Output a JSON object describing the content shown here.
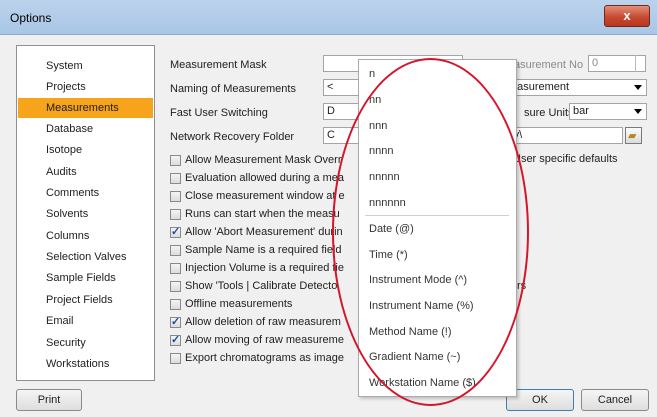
{
  "window": {
    "title": "Options",
    "close_glyph": "x"
  },
  "sidebar": {
    "items": [
      {
        "label": "System"
      },
      {
        "label": "Projects"
      },
      {
        "label": "Measurements",
        "selected": true
      },
      {
        "label": "Database"
      },
      {
        "label": "Isotope"
      },
      {
        "label": "Audits"
      },
      {
        "label": "Comments"
      },
      {
        "label": "Solvents"
      },
      {
        "label": "Columns"
      },
      {
        "label": "Selection Valves"
      },
      {
        "label": "Sample Fields"
      },
      {
        "label": "Project Fields"
      },
      {
        "label": "Email"
      },
      {
        "label": "Security"
      },
      {
        "label": "Workstations"
      }
    ]
  },
  "form": {
    "measurement_mask_label": "Measurement Mask",
    "naming_label": "Naming of Measurements",
    "naming_value_left": "<",
    "naming_value_right": "easurement",
    "fast_user_label": "Fast User Switching",
    "fast_user_value": "D",
    "network_folder_label": "Network Recovery Folder",
    "network_folder_value_left": "C",
    "network_folder_value_right": "ry\\",
    "measurement_no_label": "asurement No",
    "measurement_no_value": "0",
    "pressure_units_label": "sure Units",
    "pressure_units_value": "bar",
    "user_defaults_label": "User specific defaults"
  },
  "checkboxes": [
    {
      "label": "Allow Measurement Mask Overr",
      "checked": false
    },
    {
      "label": "Evaluation allowed during a mea",
      "checked": false
    },
    {
      "label": "Close measurement window at e",
      "checked": false
    },
    {
      "label": "Runs can start when the measu",
      "checked": false
    },
    {
      "label": "Allow 'Abort Measurement' durin",
      "checked": true
    },
    {
      "label": "Sample Name is a required field",
      "checked": false
    },
    {
      "label": "Injection Volume is a required fie",
      "checked": false
    },
    {
      "label": "Show 'Tools | Calibrate Detecto",
      "checked": false
    },
    {
      "label": "Offline measurements",
      "checked": false
    },
    {
      "label": "Allow deletion of raw measurem",
      "checked": true
    },
    {
      "label": "Allow moving of raw measureme",
      "checked": true
    },
    {
      "label": "Export chromatograms as image",
      "checked": false
    }
  ],
  "trailing_rs": "rs",
  "popup": {
    "items": [
      {
        "label": "n"
      },
      {
        "label": "nn"
      },
      {
        "label": "nnn"
      },
      {
        "label": "nnnn"
      },
      {
        "label": "nnnnn"
      },
      {
        "label": "nnnnnn"
      },
      {
        "label": "Date (@)"
      },
      {
        "label": "Time (*)"
      },
      {
        "label": "Instrument Mode (^)"
      },
      {
        "label": "Instrument Name (%)"
      },
      {
        "label": "Method Name (!)"
      },
      {
        "label": "Gradient Name (~)"
      },
      {
        "label": "Workstation Name ($)"
      }
    ]
  },
  "buttons": {
    "print": "Print",
    "ok": "OK",
    "cancel": "Cancel"
  },
  "colors": {
    "selection": "#f5a41c",
    "highlight_ellipse": "#d4162d"
  }
}
